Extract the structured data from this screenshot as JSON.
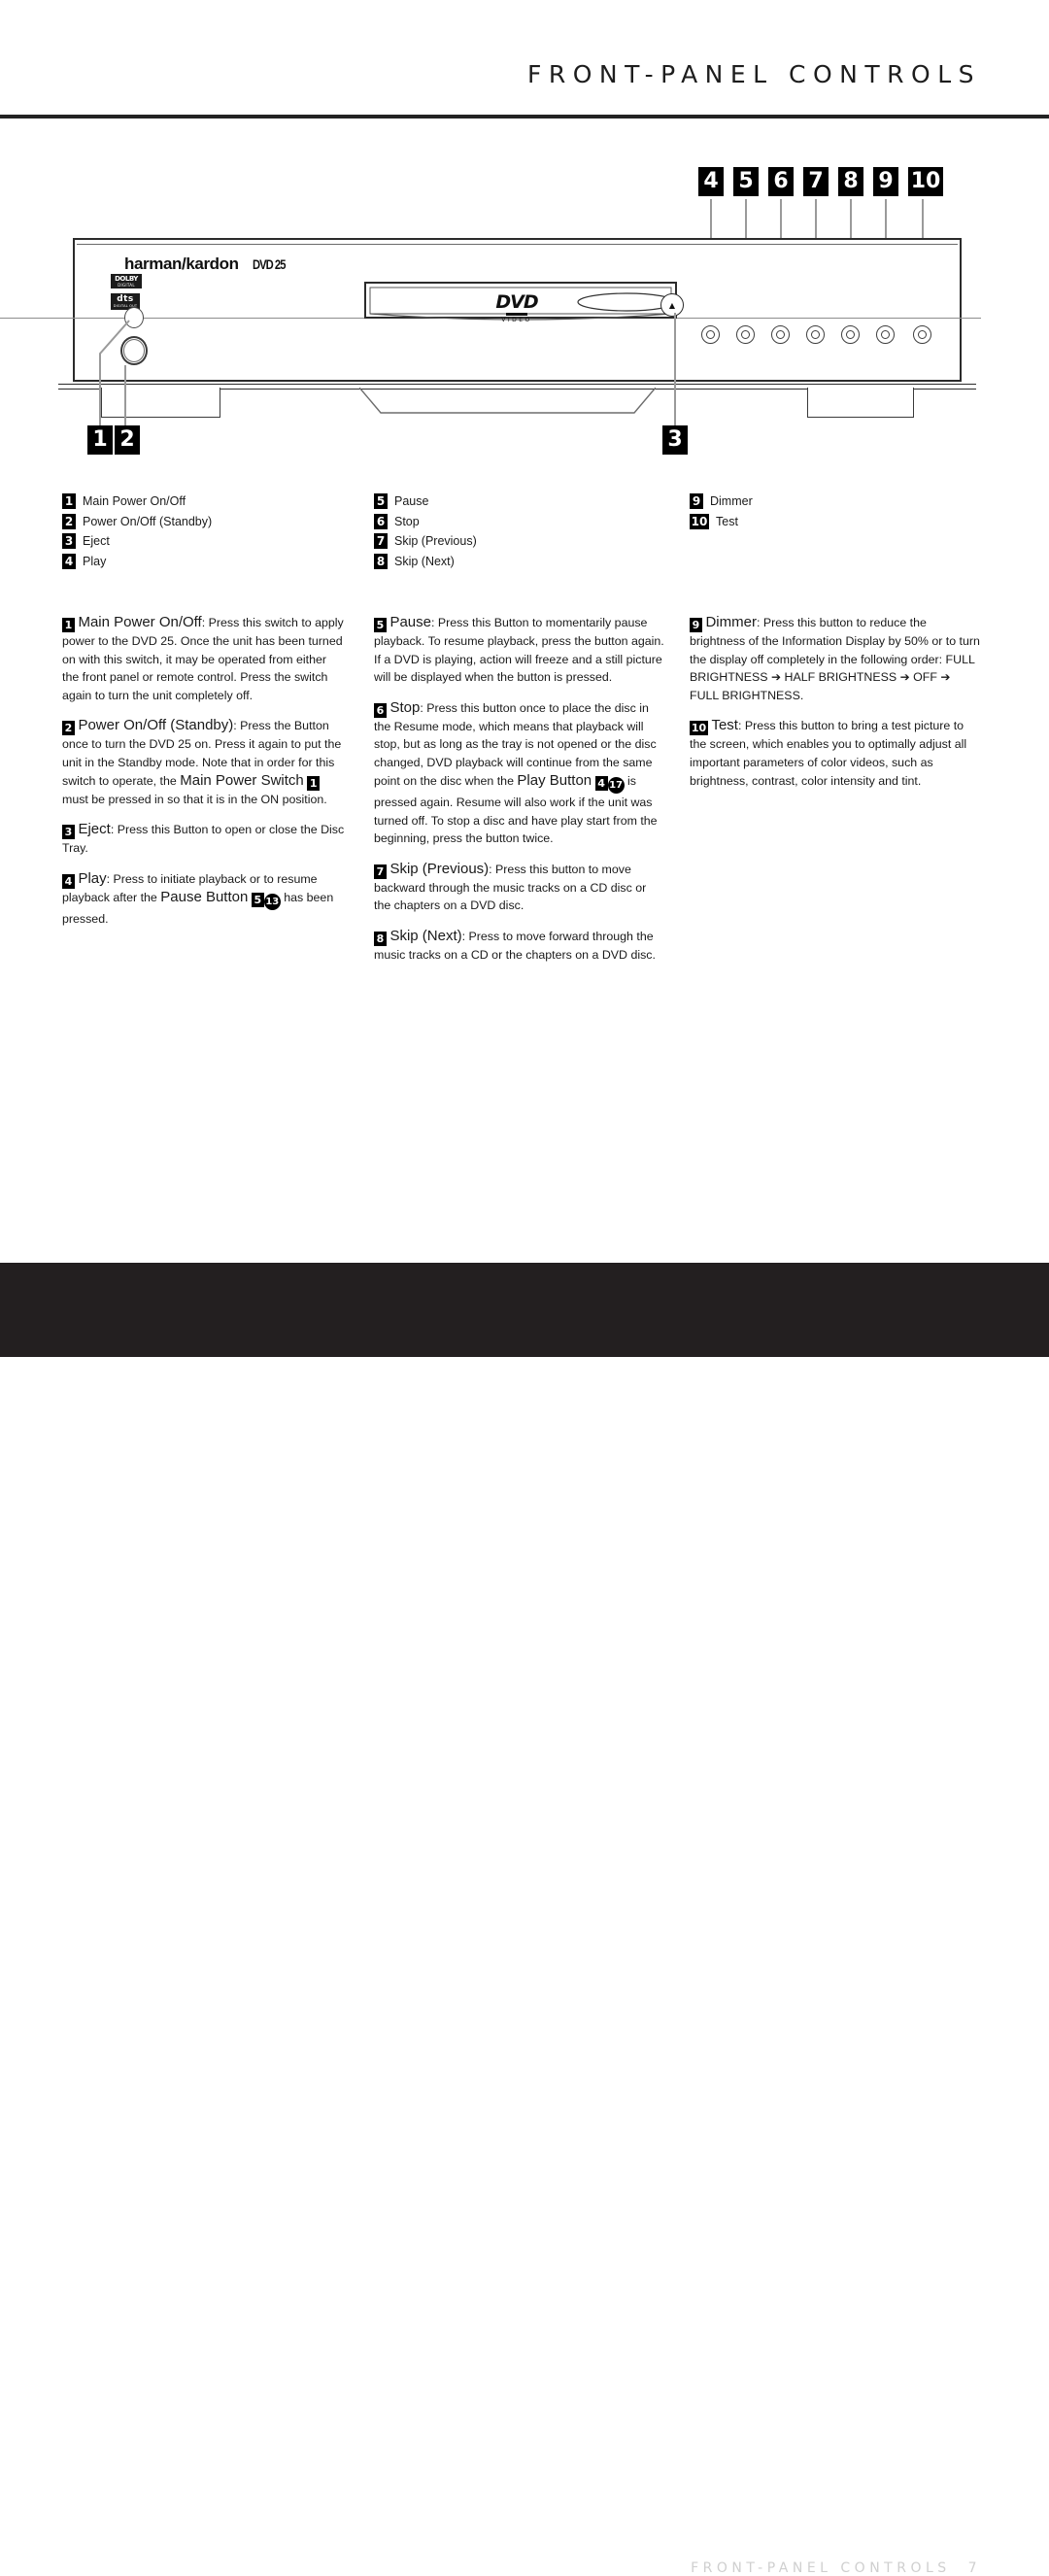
{
  "header": {
    "title": "FRONT-PANEL CONTROLS"
  },
  "device": {
    "brand": "harman/kardon",
    "model": "DVD 25",
    "logos": [
      {
        "name": "dolby-digital-logo",
        "top": "DOLBY",
        "bottom": "DIGITAL"
      },
      {
        "name": "dts-logo",
        "top": "dts",
        "bottom": "DIGITAL OUT"
      }
    ],
    "disc_tray": {
      "logo_main": "DVD",
      "logo_sub": "VIDEO",
      "eject_glyph": "▲"
    }
  },
  "callouts": [
    {
      "id": "1",
      "name": "callout-1"
    },
    {
      "id": "2",
      "name": "callout-2"
    },
    {
      "id": "3",
      "name": "callout-3"
    },
    {
      "id": "4",
      "name": "callout-4"
    },
    {
      "id": "5",
      "name": "callout-5"
    },
    {
      "id": "6",
      "name": "callout-6"
    },
    {
      "id": "7",
      "name": "callout-7"
    },
    {
      "id": "8",
      "name": "callout-8"
    },
    {
      "id": "9",
      "name": "callout-9"
    },
    {
      "id": "10",
      "name": "callout-10"
    }
  ],
  "legend": {
    "column1": [
      {
        "num": "1",
        "label": "Main Power On/Off"
      },
      {
        "num": "2",
        "label": "Power On/Off (Standby)"
      },
      {
        "num": "3",
        "label": "Eject"
      },
      {
        "num": "4",
        "label": "Play"
      }
    ],
    "column2": [
      {
        "num": "5",
        "label": "Pause"
      },
      {
        "num": "6",
        "label": "Stop"
      },
      {
        "num": "7",
        "label": "Skip (Previous)"
      },
      {
        "num": "8",
        "label": "Skip (Next)"
      }
    ],
    "column3": [
      {
        "num": "9",
        "label": "Dimmer"
      },
      {
        "num": "10",
        "label": "Test"
      }
    ]
  },
  "descriptions": {
    "item1": {
      "num": "1",
      "term": "Main Power On/Off",
      "text_a": ": Press this switch to apply power to the DVD 25. Once the unit has been turned on with this switch, it may be operated from either the front panel or remote control. Press the switch again to turn the unit completely off."
    },
    "item2": {
      "num": "2",
      "term": "Power On/Off (Standby)",
      "text_a": ": Press the Button once to turn the DVD 25 on. Press it again to put the unit in the Standby mode. Note that in order for this switch to operate, the ",
      "inline_term": "Main Power Switch",
      "inline_badge": "1",
      "text_b": " must be pressed in so that it is in the ON position."
    },
    "item3": {
      "num": "3",
      "term": "Eject",
      "text_a": ": Press this Button to open or close the Disc Tray."
    },
    "item4": {
      "num": "4",
      "term": "Play",
      "text_a": ": Press to initiate playback or to resume playback after the ",
      "inline_term": "Pause Button",
      "inline_badge_sq": "5",
      "inline_badge_rd": "13",
      "text_b": " has been pressed."
    },
    "item5": {
      "num": "5",
      "term": "Pause",
      "text_a": ": Press this Button to momentarily pause playback. To resume playback, press the button again. If a DVD is playing, action will freeze and a still picture will be displayed when the button is pressed."
    },
    "item6": {
      "num": "6",
      "term": "Stop",
      "text_a": ": Press this button once to place the disc in the Resume mode, which means that playback will stop, but as long as the tray is not opened or the disc changed, DVD playback will continue from the same point on the disc when the ",
      "inline_term": "Play Button",
      "inline_badge_sq": "4",
      "inline_badge_rd": "17",
      "text_b": " is pressed again. Resume will also work if the unit was turned off. To stop a disc and have play start from the beginning, press the button twice."
    },
    "item7": {
      "num": "7",
      "term": "Skip (Previous)",
      "text_a": ": Press this button to move backward through the music tracks on a CD disc or the chapters on a DVD disc."
    },
    "item8": {
      "num": "8",
      "term": "Skip (Next)",
      "text_a": ": Press to move forward through the music tracks on a CD or the chapters on a DVD disc."
    },
    "item9": {
      "num": "9",
      "term": "Dimmer",
      "text_a": ": Press this button to reduce the brightness of the Information Display by 50% or to turn the display off completely in the following order: FULL BRIGHTNESS ",
      "arrow1": "➔",
      "text_b": " HALF BRIGHTNESS ",
      "arrow2": "➔",
      "text_c": " OFF ",
      "arrow3": "➔",
      "text_d": " FULL BRIGHTNESS."
    },
    "item10": {
      "num": "10",
      "term": "Test",
      "text_a": ": Press this button to bring a test picture to the screen, which enables you to optimally adjust all important parameters of color videos, such as brightness, contrast, color intensity and tint."
    }
  },
  "footer": {
    "title": "FRONT-PANEL CONTROLS",
    "page": "7"
  }
}
